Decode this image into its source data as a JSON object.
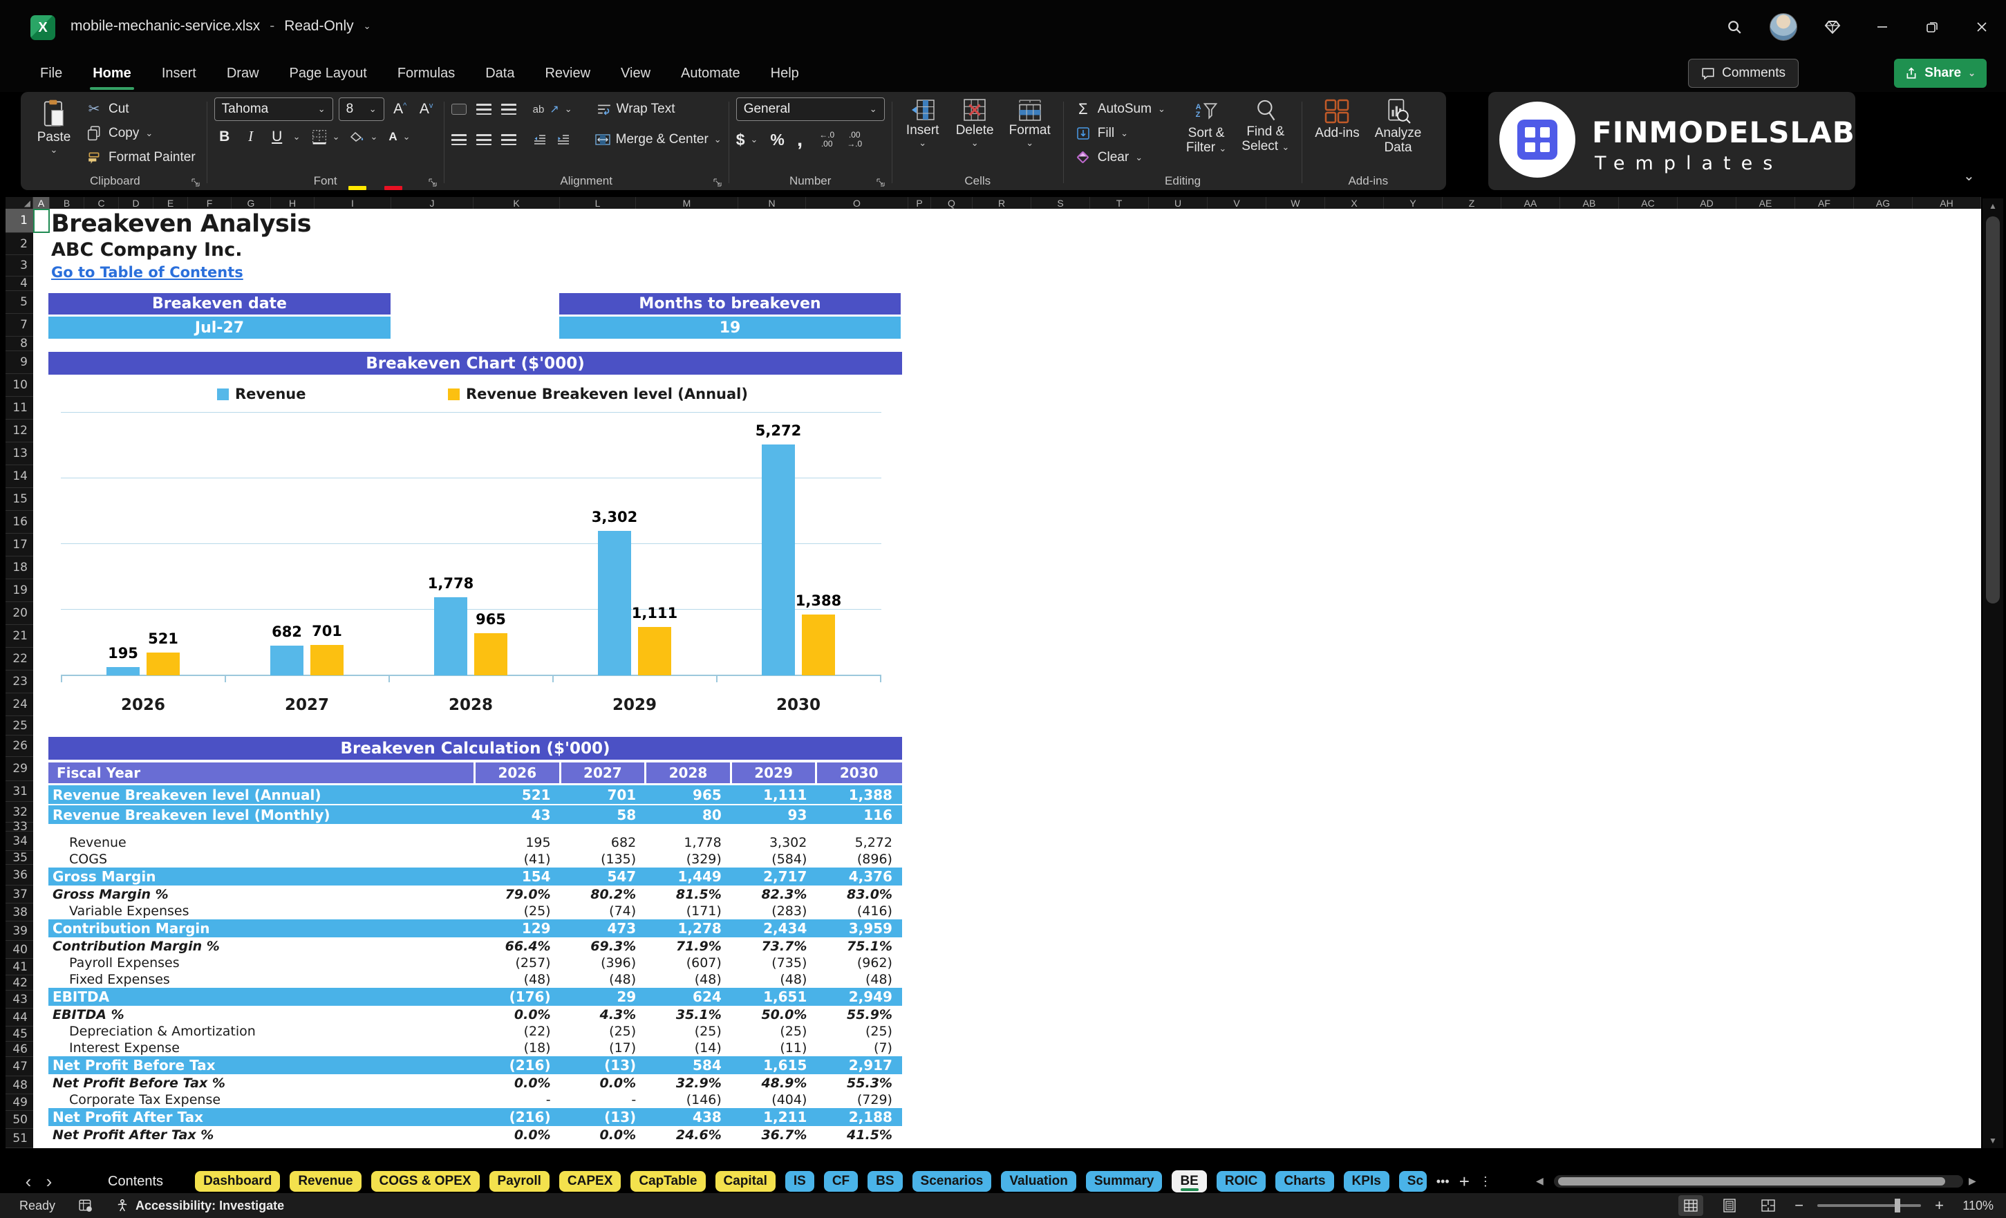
{
  "title_bar": {
    "filename": "mobile-mechanic-service.xlsx",
    "separator": "-",
    "mode": "Read-Only"
  },
  "menu": {
    "tabs": [
      "File",
      "Home",
      "Insert",
      "Draw",
      "Page Layout",
      "Formulas",
      "Data",
      "Review",
      "View",
      "Automate",
      "Help"
    ],
    "active_tab": "Home",
    "comments_label": "Comments",
    "share_label": "Share"
  },
  "ribbon": {
    "clipboard": {
      "paste": "Paste",
      "cut": "Cut",
      "copy": "Copy",
      "format_painter": "Format Painter",
      "group_label": "Clipboard"
    },
    "font": {
      "family": "Tahoma",
      "size": "8",
      "bold": "B",
      "italic": "I",
      "underline": "U",
      "group_label": "Font"
    },
    "alignment": {
      "orientation": "ab",
      "wrap_text": "Wrap Text",
      "merge_center": "Merge & Center",
      "group_label": "Alignment"
    },
    "number": {
      "format": "General",
      "dollar": "$",
      "percent": "%",
      "comma": ",",
      "inc_top": "←.0",
      "inc_bot": ".00",
      "dec_top": ".00",
      "dec_bot": "→.0",
      "group_label": "Number"
    },
    "cells": {
      "insert": "Insert",
      "delete": "Delete",
      "format": "Format",
      "group_label": "Cells"
    },
    "editing": {
      "autosum": "AutoSum",
      "fill": "Fill",
      "clear": "Clear",
      "sort_line1": "Sort &",
      "sort_line2": "Filter",
      "find_line1": "Find &",
      "find_line2": "Select",
      "group_label": "Editing"
    },
    "addins": {
      "addins": "Add-ins",
      "analyze_line1": "Analyze",
      "analyze_line2": "Data",
      "group_label": "Add-ins"
    }
  },
  "logo": {
    "name": "FINMODELSLAB",
    "subtitle": "Templates"
  },
  "grid": {
    "columns": [
      "A",
      "B",
      "C",
      "D",
      "E",
      "F",
      "G",
      "H",
      "I",
      "J",
      "K",
      "L",
      "M",
      "N",
      "O",
      "P",
      "Q",
      "R",
      "S",
      "T",
      "U",
      "V",
      "W",
      "X",
      "Y",
      "Z",
      "AA",
      "AB",
      "AC",
      "AD",
      "AE",
      "AF",
      "AG",
      "AH"
    ],
    "rows": [
      "1",
      "2",
      "3",
      "4",
      "5",
      "7",
      "8",
      "9",
      "10",
      "11",
      "12",
      "13",
      "14",
      "15",
      "16",
      "17",
      "18",
      "19",
      "20",
      "21",
      "22",
      "23",
      "24",
      "25",
      "26",
      "29",
      "31",
      "32",
      "33",
      "34",
      "35",
      "36",
      "37",
      "38",
      "39",
      "40",
      "41",
      "42",
      "43",
      "44",
      "45",
      "46",
      "47",
      "48",
      "49",
      "50",
      "51"
    ],
    "selected_column": "A",
    "selected_row": "1"
  },
  "sheet": {
    "title": "Breakeven Analysis",
    "company": "ABC Company Inc.",
    "link": "Go to Table of Contents",
    "breakeven_date_label": "Breakeven date",
    "breakeven_date_value": "Jul-27",
    "months_label": "Months to breakeven",
    "months_value": "19"
  },
  "chart_data": {
    "type": "bar",
    "title": "Breakeven Chart ($'000)",
    "categories": [
      "2026",
      "2027",
      "2028",
      "2029",
      "2030"
    ],
    "series": [
      {
        "name": "Revenue",
        "color": "#56b8e9",
        "values": [
          195,
          682,
          1778,
          3302,
          5272
        ],
        "labels": [
          "195",
          "682",
          "1,778",
          "3,302",
          "5,272"
        ]
      },
      {
        "name": "Revenue Breakeven level (Annual)",
        "color": "#fcc011",
        "values": [
          521,
          701,
          965,
          1111,
          1388
        ],
        "labels": [
          "521",
          "701",
          "965",
          "1,111",
          "1,388"
        ]
      }
    ],
    "xlabel": "",
    "ylabel": "",
    "ylim": [
      0,
      6000
    ],
    "gridline_step": 1500,
    "grid": true,
    "legend_position": "top",
    "y_axis_labels_visible": false
  },
  "calc_table": {
    "title": "Breakeven Calculation ($'000)",
    "fiscal_label": "Fiscal Year",
    "years": [
      "2026",
      "2027",
      "2028",
      "2029",
      "2030"
    ],
    "rows": [
      {
        "label": "Revenue Breakeven level (Annual)",
        "style": "highlight",
        "values": [
          "521",
          "701",
          "965",
          "1,111",
          "1,388"
        ]
      },
      {
        "label": "Revenue Breakeven level (Monthly)",
        "style": "highlight",
        "values": [
          "43",
          "58",
          "80",
          "93",
          "116"
        ]
      },
      {
        "label": "",
        "style": "spacer",
        "values": [
          "",
          "",
          "",
          "",
          ""
        ]
      },
      {
        "label": "Revenue",
        "style": "item",
        "values": [
          "195",
          "682",
          "1,778",
          "3,302",
          "5,272"
        ]
      },
      {
        "label": "COGS",
        "style": "item",
        "values": [
          "(41)",
          "(135)",
          "(329)",
          "(584)",
          "(896)"
        ]
      },
      {
        "label": "Gross Margin",
        "style": "total",
        "values": [
          "154",
          "547",
          "1,449",
          "2,717",
          "4,376"
        ]
      },
      {
        "label": "Gross Margin %",
        "style": "percent",
        "values": [
          "79.0%",
          "80.2%",
          "81.5%",
          "82.3%",
          "83.0%"
        ]
      },
      {
        "label": "Variable Expenses",
        "style": "item",
        "values": [
          "(25)",
          "(74)",
          "(171)",
          "(283)",
          "(416)"
        ]
      },
      {
        "label": "Contribution Margin",
        "style": "total",
        "values": [
          "129",
          "473",
          "1,278",
          "2,434",
          "3,959"
        ]
      },
      {
        "label": "Contribution Margin %",
        "style": "percent",
        "values": [
          "66.4%",
          "69.3%",
          "71.9%",
          "73.7%",
          "75.1%"
        ]
      },
      {
        "label": "Payroll Expenses",
        "style": "item",
        "values": [
          "(257)",
          "(396)",
          "(607)",
          "(735)",
          "(962)"
        ]
      },
      {
        "label": "Fixed Expenses",
        "style": "item",
        "values": [
          "(48)",
          "(48)",
          "(48)",
          "(48)",
          "(48)"
        ]
      },
      {
        "label": "EBITDA",
        "style": "total",
        "values": [
          "(176)",
          "29",
          "624",
          "1,651",
          "2,949"
        ]
      },
      {
        "label": "EBITDA %",
        "style": "percent",
        "values": [
          "0.0%",
          "4.3%",
          "35.1%",
          "50.0%",
          "55.9%"
        ]
      },
      {
        "label": "Depreciation & Amortization",
        "style": "item",
        "values": [
          "(22)",
          "(25)",
          "(25)",
          "(25)",
          "(25)"
        ]
      },
      {
        "label": "Interest Expense",
        "style": "item",
        "values": [
          "(18)",
          "(17)",
          "(14)",
          "(11)",
          "(7)"
        ]
      },
      {
        "label": "Net Profit Before Tax",
        "style": "total",
        "values": [
          "(216)",
          "(13)",
          "584",
          "1,615",
          "2,917"
        ]
      },
      {
        "label": "Net Profit Before Tax %",
        "style": "percent",
        "values": [
          "0.0%",
          "0.0%",
          "32.9%",
          "48.9%",
          "55.3%"
        ]
      },
      {
        "label": "Corporate Tax Expense",
        "style": "item",
        "values": [
          "-",
          "-",
          "(146)",
          "(404)",
          "(729)"
        ]
      },
      {
        "label": "Net Profit After Tax",
        "style": "total",
        "values": [
          "(216)",
          "(13)",
          "438",
          "1,211",
          "2,188"
        ]
      },
      {
        "label": "Net Profit After Tax %",
        "style": "percent",
        "values": [
          "0.0%",
          "0.0%",
          "24.6%",
          "36.7%",
          "41.5%"
        ]
      }
    ]
  },
  "sheet_tabs": {
    "contents_label": "Contents",
    "active_tab": "BE",
    "tabs": [
      {
        "label": "Dashboard",
        "color": "yellow"
      },
      {
        "label": "Revenue",
        "color": "yellow"
      },
      {
        "label": "COGS & OPEX",
        "color": "yellow"
      },
      {
        "label": "Payroll",
        "color": "yellow"
      },
      {
        "label": "CAPEX",
        "color": "yellow"
      },
      {
        "label": "CapTable",
        "color": "yellow"
      },
      {
        "label": "Capital",
        "color": "yellow"
      },
      {
        "label": "IS",
        "color": "blue"
      },
      {
        "label": "CF",
        "color": "blue"
      },
      {
        "label": "BS",
        "color": "blue"
      },
      {
        "label": "Scenarios",
        "color": "blue"
      },
      {
        "label": "Valuation",
        "color": "blue"
      },
      {
        "label": "Summary",
        "color": "blue"
      },
      {
        "label": "BE",
        "color": "active"
      },
      {
        "label": "ROIC",
        "color": "blue"
      },
      {
        "label": "Charts",
        "color": "blue"
      },
      {
        "label": "KPIs",
        "color": "blue"
      },
      {
        "label": "Sc",
        "color": "blue",
        "clipped": true
      }
    ]
  },
  "status_bar": {
    "ready": "Ready",
    "accessibility": "Accessibility: Investigate",
    "zoom_level": "110%"
  },
  "colors": {
    "accent_purple": "#4b51c5",
    "fiscal_purple": "#696dd4",
    "highlight_blue": "#49b2e8",
    "bar_blue": "#56b8e9",
    "bar_yellow": "#fcc011",
    "tab_yellow": "#f3e14d",
    "tab_blue": "#4ab3e8",
    "excel_green": "#21a366",
    "share_green": "#1f9150",
    "link_blue": "#2a6fdb"
  },
  "icons": {
    "chevron_down": "⌄",
    "chevron_left": "‹",
    "chevron_right": "›",
    "more": "•••",
    "vertical_dots": "⋮",
    "plus": "+",
    "minus": "−",
    "scissors": "✂",
    "sigma": "Σ",
    "select_all": "◢",
    "left_triangle": "◀",
    "right_triangle": "▶",
    "up_triangle": "▲",
    "down_triangle": "▼",
    "orientation_arrow": "↗",
    "grow_caret": "^",
    "shrink_caret": "v",
    "close": "✕",
    "minimize": "—"
  }
}
